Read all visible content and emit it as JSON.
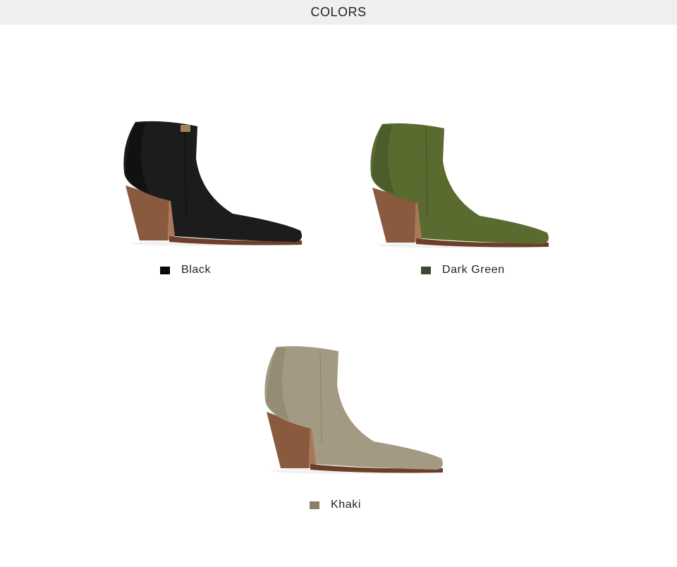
{
  "header": {
    "title": "COLORS"
  },
  "variants": [
    {
      "name": "Black",
      "swatch_color": "#0a0a0a",
      "boot_color": "#1c1c1c",
      "boot_shade": "#0d0d0d"
    },
    {
      "name": "Dark Green",
      "swatch_color": "#3b4a2c",
      "boot_color": "#5a6b30",
      "boot_shade": "#46552a"
    },
    {
      "name": "Khaki",
      "swatch_color": "#8c7f6a",
      "boot_color": "#a49a84",
      "boot_shade": "#8f8670"
    }
  ],
  "heel_color": "#8a5a3e",
  "sole_color": "#6b3f2a"
}
